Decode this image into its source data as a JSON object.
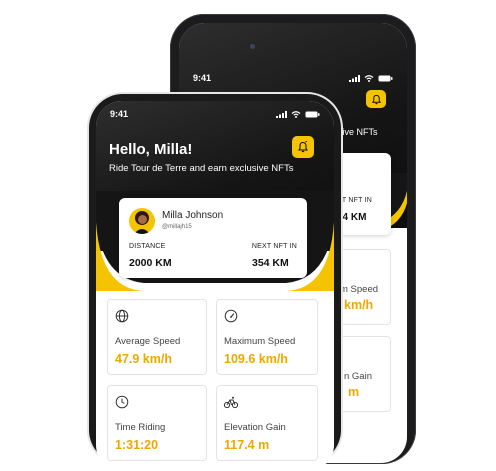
{
  "back_phone": {
    "status_time": "9:41",
    "subtitle_fragment": "xclusive NFTs",
    "next_nft_fragment": "XT NFT IN",
    "next_nft_value_fragment": "54 KM",
    "tile_1_label_fragment": "m Speed",
    "tile_1_value_fragment": "km/h",
    "tile_2_label_fragment": "n Gain",
    "tile_2_value_fragment": "m"
  },
  "front_phone": {
    "status_time": "9:41",
    "greeting": "Hello, Milla!",
    "subtitle": "Ride Tour de Terre and earn exclusive NFTs",
    "profile": {
      "name": "Milla Johnson",
      "handle": "@millajh15",
      "distance_label": "DISTANCE",
      "distance_value": "2000 KM",
      "next_nft_label": "NEXT NFT IN",
      "next_nft_value": "354 KM"
    },
    "stats": [
      {
        "icon": "globe-icon",
        "label": "Average Speed",
        "value": "47.9 km/h"
      },
      {
        "icon": "speedometer-icon",
        "label": "Maximum Speed",
        "value": "109.6 km/h"
      },
      {
        "icon": "clock-icon",
        "label": "Time Riding",
        "value": "1:31:20"
      },
      {
        "icon": "bicycle-icon",
        "label": "Elevation Gain",
        "value": "117.4 m"
      }
    ]
  },
  "colors": {
    "accent": "#f5c400",
    "value_text": "#f0a800",
    "hero_dark": "#151515"
  }
}
